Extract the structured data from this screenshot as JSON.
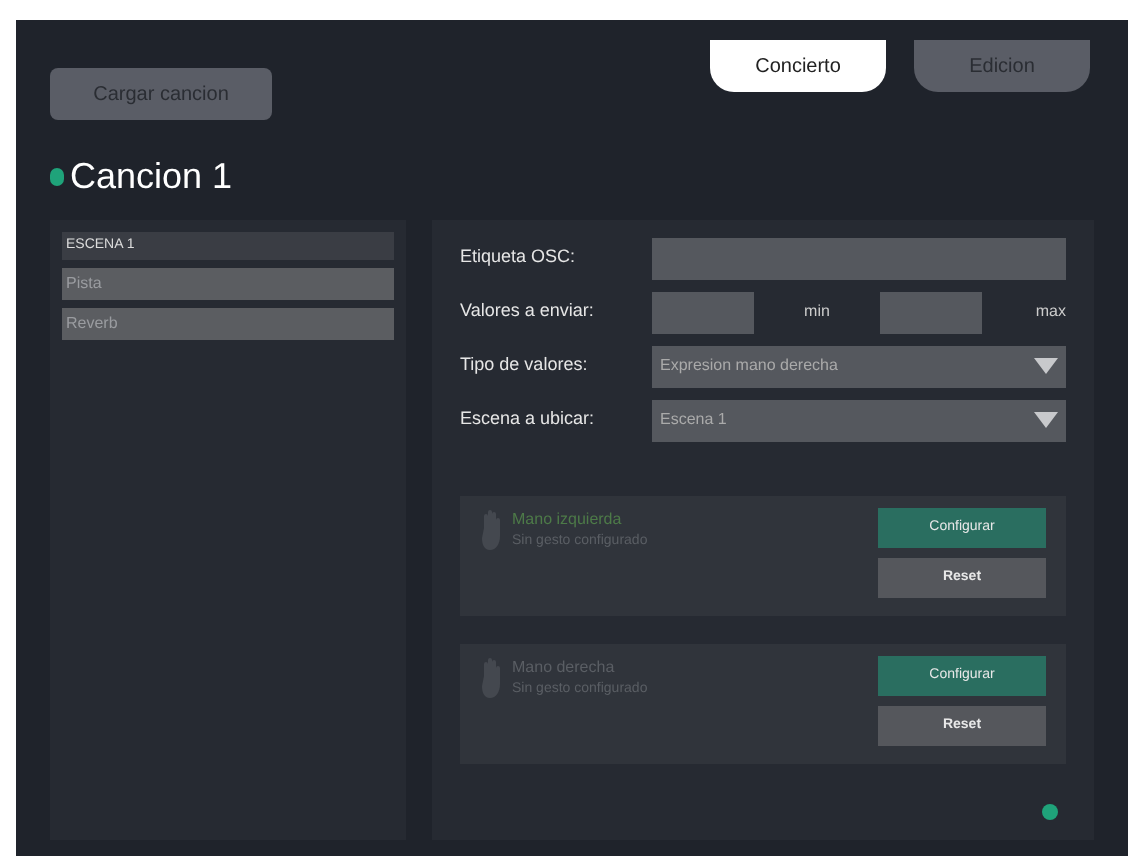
{
  "load_button": "Cargar cancion",
  "tabs": [
    {
      "label": "Concierto",
      "selected": true
    },
    {
      "label": "Edicion",
      "selected": false
    }
  ],
  "song_title": "Cancion 1",
  "scenes": [
    {
      "title": "ESCENA 1",
      "items": [
        {
          "label": "Pista"
        },
        {
          "label": "Reverb"
        }
      ]
    }
  ],
  "form": {
    "osc_label": "Etiqueta OSC:",
    "values_label": "Valores a enviar:",
    "min_label": "min",
    "max_label": "max",
    "type_label": "Tipo de valores:",
    "type_value": "Expresion mano derecha",
    "scene_label": "Escena a ubicar:",
    "scene_value": "Escena 1"
  },
  "gestures": [
    {
      "title": "Mano izquierda",
      "subtitle": "Sin gesto configurado",
      "active": true,
      "configure": "Configurar",
      "reset": "Reset"
    },
    {
      "title": "Mano derecha",
      "subtitle": "Sin gesto configurado",
      "active": false,
      "configure": "Configurar",
      "reset": "Reset"
    }
  ]
}
